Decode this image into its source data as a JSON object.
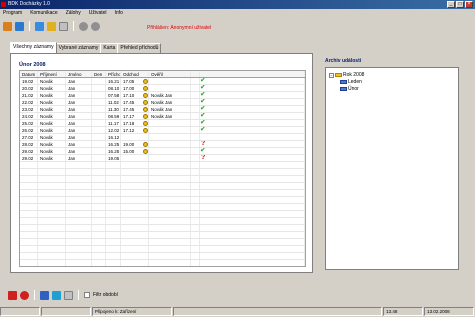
{
  "window": {
    "title": "BDK Docházky 1.0",
    "buttons": [
      "_",
      "□",
      "×"
    ]
  },
  "menu": [
    "Program",
    "Komunikace",
    "Zálohy",
    "Uživatel",
    "Info"
  ],
  "toolbar": {
    "icons": [
      "user-icon",
      "users-icon",
      "edit-icon",
      "copy-icon",
      "export-icon",
      "settings-icon",
      "power-icon"
    ]
  },
  "privileged_user": "Přihlášen: Anonymní uživatel",
  "tabs": [
    "Všechny záznamy",
    "Vybrané záznamy",
    "Karta",
    "Přehled příchodů"
  ],
  "active_tab": 0,
  "month_title": "Únor 2008",
  "table": {
    "columns": [
      "Datum",
      "Příjmení",
      "Jméno",
      "Den",
      "Příchod",
      "Odchod",
      "Ověřil",
      "",
      ""
    ],
    "rows": [
      [
        "19.02",
        "Novák",
        "Jan",
        "",
        "16.21",
        "17.05",
        "",
        "",
        "ok"
      ],
      [
        "20.02",
        "Novák",
        "Jan",
        "",
        "08.10",
        "17.00",
        "",
        "",
        "ok"
      ],
      [
        "21.02",
        "Novák",
        "Jan",
        "",
        "07.58",
        "17.10",
        "Novák Jan",
        "",
        "ok"
      ],
      [
        "22.02",
        "Novák",
        "Jan",
        "",
        "11.02",
        "17.45",
        "Novák Jan",
        "",
        "ok"
      ],
      [
        "23.02",
        "Novák",
        "Jan",
        "",
        "11.30",
        "17.45",
        "Novák Jan",
        "",
        "ok"
      ],
      [
        "24.02",
        "Novák",
        "Jan",
        "",
        "08.59",
        "17.17",
        "Novák Jan",
        "",
        "ok"
      ],
      [
        "25.02",
        "Novák",
        "Jan",
        "",
        "11.17",
        "17.18",
        "",
        "",
        "ok"
      ],
      [
        "26.02",
        "Novák",
        "Jan",
        "",
        "12.02",
        "17.12",
        "",
        "",
        "ok"
      ],
      [
        "27.02",
        "Novák",
        "Jan",
        "",
        "16.12",
        "",
        "",
        "",
        ""
      ],
      [
        "28.02",
        "Novák",
        "Jan",
        "",
        "16.25",
        "19.00",
        "",
        "",
        "q"
      ],
      [
        "29.02",
        "Novák",
        "Jan",
        "",
        "16.25",
        "15.00",
        "",
        "",
        "ok"
      ],
      [
        "29.02",
        "Novák",
        "Jan",
        "",
        "19.05",
        "",
        "",
        "",
        "q"
      ]
    ],
    "empty_rows": 16
  },
  "archive": {
    "title": "Archiv událostí",
    "tree": [
      {
        "label": "Rok 2008",
        "level": 0
      },
      {
        "label": "Leden",
        "level": 1
      },
      {
        "label": "Únor",
        "level": 1
      }
    ]
  },
  "bottom": {
    "checkbox_label": "Filtr období"
  },
  "status": {
    "panels": [
      "",
      "",
      "Připojeno k: Zařízení",
      "",
      "13.48",
      "13.02.2008"
    ]
  },
  "colors": {
    "ok": "#2da42d",
    "warn": "#d00000",
    "title": "#0a246a"
  }
}
